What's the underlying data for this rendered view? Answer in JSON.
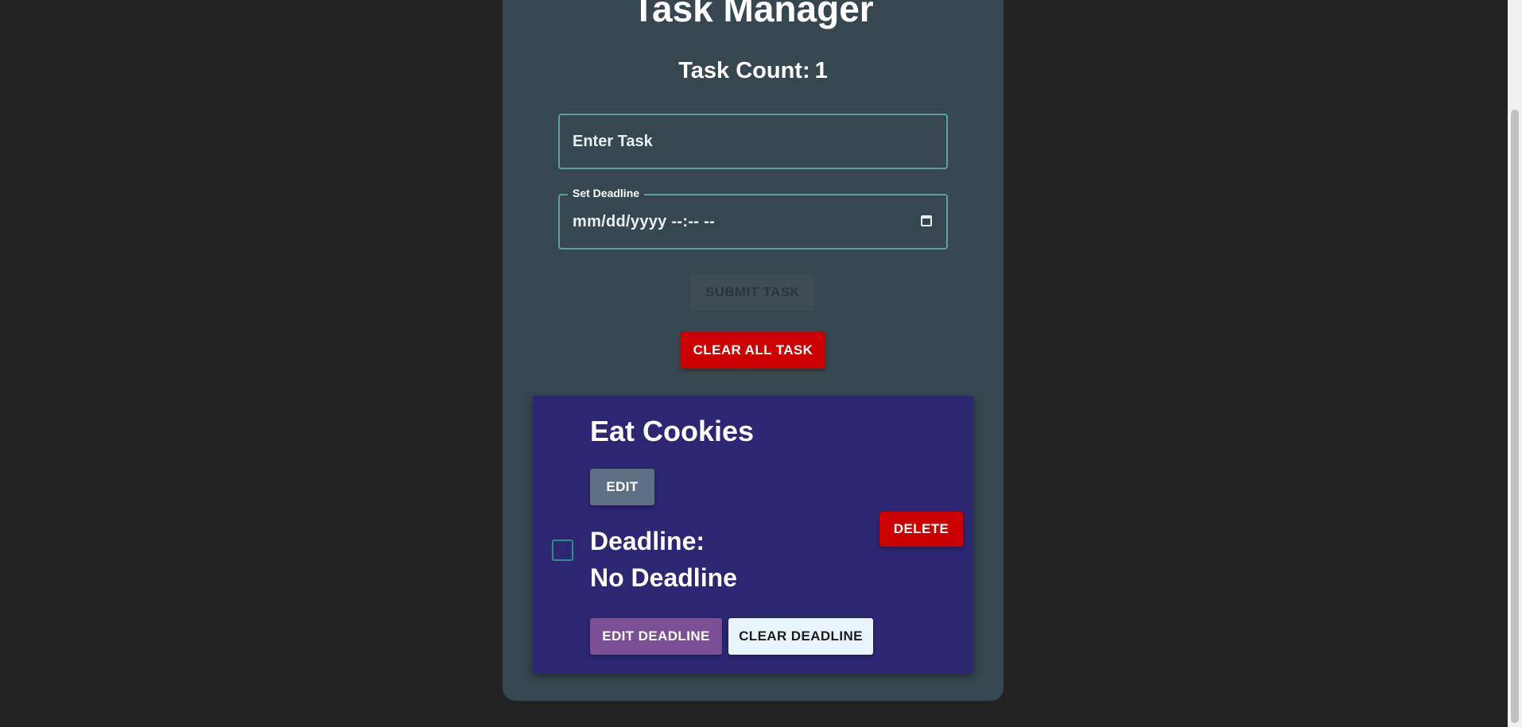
{
  "app": {
    "title": "Task Manager",
    "task_count_label": "Task Count:",
    "task_count": "1"
  },
  "form": {
    "task_placeholder": "Enter Task",
    "deadline_label": "Set Deadline",
    "deadline_placeholder": "mm/dd/yyyy --:-- --",
    "submit_label": "SUBMIT TASK",
    "clear_all_label": "CLEAR ALL TASK"
  },
  "tasks": [
    {
      "name": "Eat Cookies",
      "edit_label": "EDIT",
      "deadline_label": "Deadline:",
      "deadline_value": "No Deadline",
      "delete_label": "DELETE",
      "edit_deadline_label": "EDIT DEADLINE",
      "clear_deadline_label": "CLEAR DEADLINE",
      "completed": false
    }
  ],
  "colors": {
    "background": "#222222",
    "card": "#37474f",
    "task_card": "#2d2673",
    "danger": "#cc0000",
    "field_border": "#5f9ea0",
    "edit_button": "#5e7184",
    "edit_deadline_button": "#7b4f96",
    "clear_deadline_button": "#eaf4ff"
  },
  "icons": {
    "calendar": "calendar-icon",
    "checkbox": "checkbox-icon",
    "cursor": "mouse-cursor-icon"
  }
}
